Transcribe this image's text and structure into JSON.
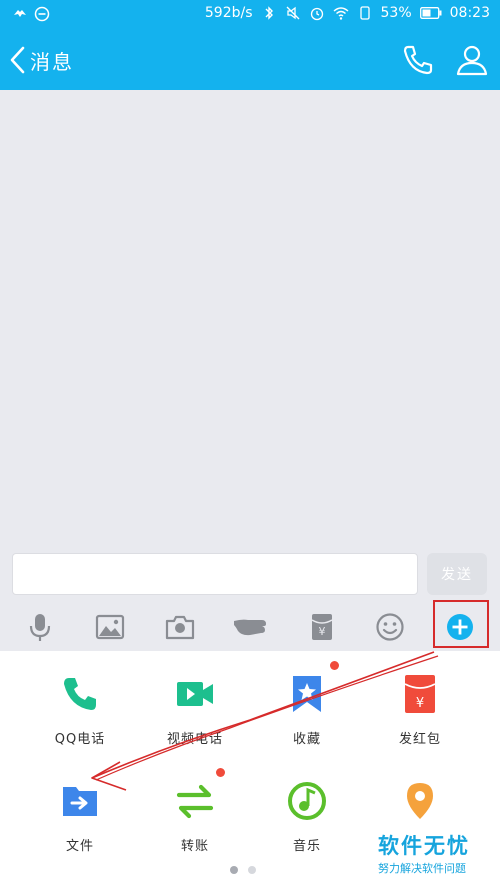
{
  "status_bar": {
    "net_speed": "592b/s",
    "battery": "53%",
    "time": "08:23"
  },
  "header": {
    "back_label": "消息",
    "icons": [
      "phone-icon",
      "person-icon"
    ]
  },
  "input": {
    "placeholder": "",
    "send_label": "发送"
  },
  "toolbar": {
    "items": [
      "microphone-icon",
      "image-icon",
      "camera-icon",
      "poke-icon",
      "red-packet-icon",
      "emoji-icon",
      "plus-icon"
    ]
  },
  "panel": {
    "items": [
      {
        "label": "QQ电话",
        "icon": "phone-icon",
        "color": "#1dbf8e",
        "badge": false
      },
      {
        "label": "视频电话",
        "icon": "video-camera-icon",
        "color": "#1dbf8e",
        "badge": false
      },
      {
        "label": "收藏",
        "icon": "bookmark-star-icon",
        "color": "#3d86ea",
        "badge": true
      },
      {
        "label": "发红包",
        "icon": "red-packet-icon",
        "color": "#f04b3b",
        "badge": false
      },
      {
        "label": "文件",
        "icon": "folder-icon",
        "color": "#3d86ea",
        "badge": false
      },
      {
        "label": "转账",
        "icon": "transfer-icon",
        "color": "#5bbf2c",
        "badge": true
      },
      {
        "label": "音乐",
        "icon": "music-icon",
        "color": "#5bbf2c",
        "badge": false
      },
      {
        "label": "位置",
        "icon": "location-pin-icon",
        "color": "#f5a23c",
        "badge": false
      }
    ],
    "page_count": 2,
    "active_page": 1
  },
  "watermark": {
    "title": "软件无忧",
    "subtitle": "努力解决软件问题"
  },
  "colors": {
    "brand": "#14b2ee",
    "annotation": "#d62b2b"
  }
}
